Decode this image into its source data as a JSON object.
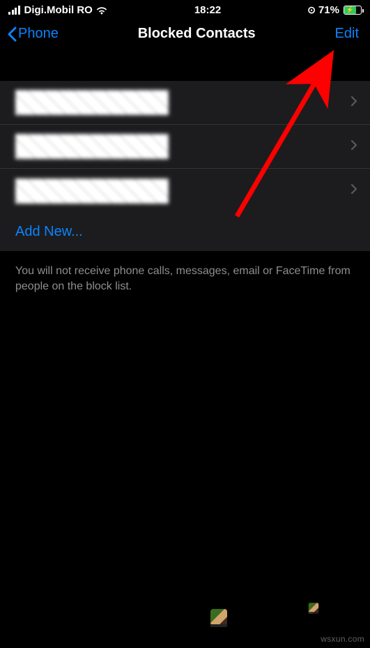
{
  "status": {
    "carrier": "Digi.Mobil RO",
    "time": "18:22",
    "battery_pct": "71%"
  },
  "nav": {
    "back_label": "Phone",
    "title": "Blocked Contacts",
    "edit_label": "Edit"
  },
  "contacts": [
    {
      "name": ""
    },
    {
      "name": ""
    },
    {
      "name": ""
    }
  ],
  "add_new_label": "Add New...",
  "footer": "You will not receive phone calls, messages, email or FaceTime from people on the block list.",
  "watermark": "wsxun.com"
}
